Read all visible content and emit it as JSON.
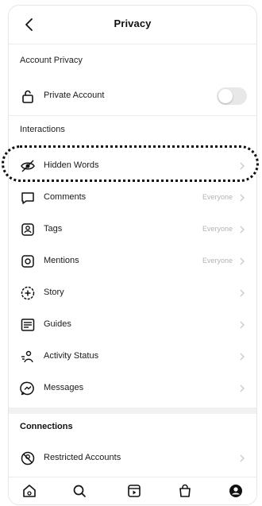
{
  "header": {
    "title": "Privacy",
    "back_icon": "chevron-left-icon"
  },
  "sections": {
    "account_privacy": "Account Privacy",
    "interactions": "Interactions",
    "connections": "Connections"
  },
  "private_account": {
    "label": "Private Account",
    "icon": "lock-icon",
    "toggle_on": false
  },
  "rows": [
    {
      "label": "Hidden Words",
      "value": "",
      "icon": "eye-icon"
    },
    {
      "label": "Comments",
      "value": "Everyone",
      "icon": "comment-icon"
    },
    {
      "label": "Tags",
      "value": "Everyone",
      "icon": "tag-icon"
    },
    {
      "label": "Mentions",
      "value": "Everyone",
      "icon": "mention-icon"
    },
    {
      "label": "Story",
      "value": "",
      "icon": "story-icon"
    },
    {
      "label": "Guides",
      "value": "",
      "icon": "guides-icon"
    },
    {
      "label": "Activity Status",
      "value": "",
      "icon": "activity-icon"
    },
    {
      "label": "Messages",
      "value": "",
      "icon": "messages-icon"
    }
  ],
  "connections_rows": [
    {
      "label": "Restricted Accounts",
      "value": "",
      "icon": "restricted-icon"
    }
  ],
  "tabbar": [
    "home-icon",
    "search-icon",
    "reels-icon",
    "shop-icon",
    "profile-icon"
  ],
  "colors": {
    "toggle_off": "#e8e8e8",
    "secondary_text": "#b3b3b3",
    "divider": "#ececec"
  }
}
